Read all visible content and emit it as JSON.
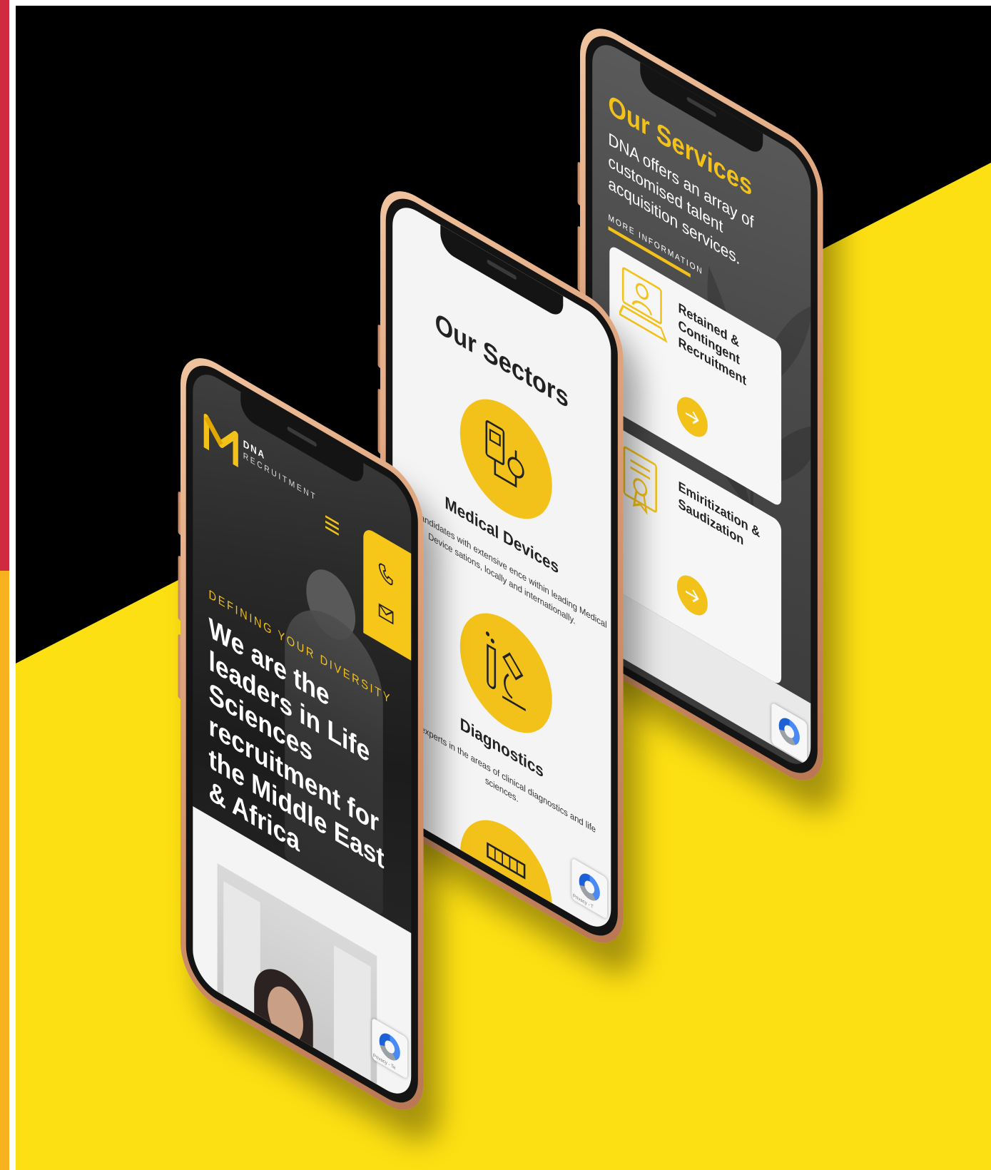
{
  "colors": {
    "accent_yellow": "#f3c21a",
    "bg_black": "#000000",
    "bg_yellow": "#fde013",
    "left_strip_red": "#cf2a3f",
    "left_strip_orange": "#f7b21e",
    "phone_frame_rose_gold": "#dba07a"
  },
  "phone_home": {
    "logo": {
      "name": "DNA",
      "subtitle": "RECRUITMENT",
      "icon": "dna-logo-icon"
    },
    "menu_icon": "hamburger-menu-icon",
    "contact": {
      "phone_icon": "phone-icon",
      "email_icon": "mail-icon"
    },
    "hero": {
      "kicker": "DEFINING YOUR DIVERSITY",
      "headline": "We are the leaders in Life Sciences recruitment for the Middle East & Africa"
    },
    "recaptcha": {
      "icon": "recaptcha-icon",
      "text": "Privacy - Te"
    }
  },
  "phone_sectors": {
    "title": "Our Sectors",
    "sectors": [
      {
        "name": "Medical Devices",
        "description": "rcing candidates with extensive ence within leading Medical Device sations, locally and internationally.",
        "icon": "medical-device-icon"
      },
      {
        "name": "Diagnostics",
        "description": "ing experts in the areas of clinical diagnostics and life sciences.",
        "icon": "microscope-icon"
      },
      {
        "name": "",
        "description": "",
        "icon": "device-icon"
      }
    ],
    "recaptcha": {
      "icon": "recaptcha-icon",
      "text": "Privacy - T"
    }
  },
  "phone_services": {
    "title": "Our Services",
    "description": "DNA offers an array of customised talent acquisition services.",
    "more_link": "MORE INFORMATION",
    "services": [
      {
        "title": "Retained & Contingent Recruitment",
        "icon": "recruiter-laptop-icon",
        "arrow": "arrow-right-icon"
      },
      {
        "title": "Emiritization & Saudization",
        "icon": "certificate-icon",
        "arrow": "arrow-right-icon"
      }
    ],
    "recaptcha": {
      "icon": "recaptcha-icon"
    }
  }
}
